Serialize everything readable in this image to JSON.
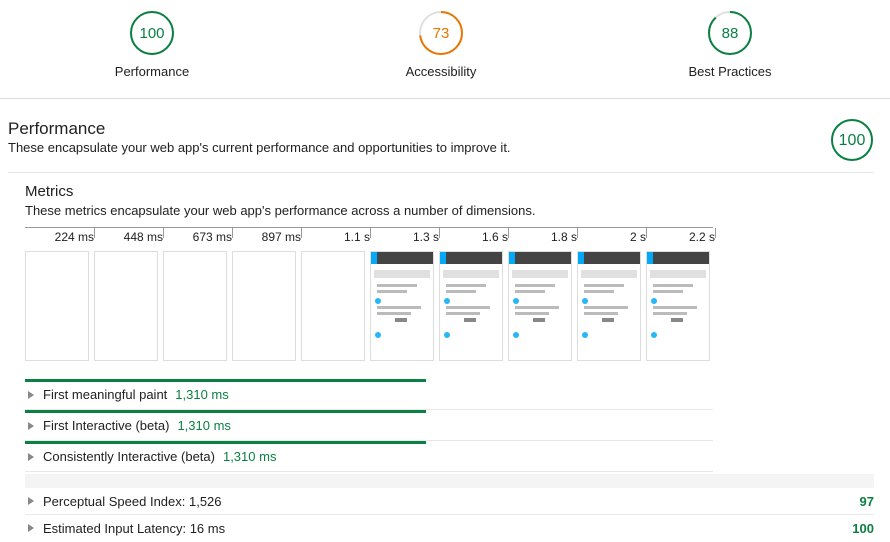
{
  "colors": {
    "pass": "#0b8043",
    "average": "#e67700",
    "track": "#e0e0e0",
    "timeline_bar": "#0b8043"
  },
  "categories": [
    {
      "score": "100",
      "label": "Performance",
      "status": "pass",
      "fraction": 1.0
    },
    {
      "score": "73",
      "label": "Accessibility",
      "status": "average",
      "fraction": 0.73
    },
    {
      "score": "88",
      "label": "Best Practices",
      "status": "pass",
      "fraction": 0.88
    }
  ],
  "section": {
    "title": "Performance",
    "description": "These encapsulate your web app's current performance and opportunities to improve it.",
    "score": "100"
  },
  "metrics": {
    "title": "Metrics",
    "description": "These metrics encapsulate your web app's performance across a number of dimensions.",
    "timeline_ticks": [
      "224 ms",
      "448 ms",
      "673 ms",
      "897 ms",
      "1.1 s",
      "1.3 s",
      "1.6 s",
      "1.8 s",
      "2 s",
      "2.2 s"
    ],
    "frames_painted": [
      false,
      false,
      false,
      false,
      false,
      true,
      true,
      true,
      true,
      true
    ],
    "items": [
      {
        "name": "First meaningful paint",
        "value": "1,310 ms",
        "progress_fraction": 0.583
      },
      {
        "name": "First Interactive (beta)",
        "value": "1,310 ms",
        "progress_fraction": 0.583
      },
      {
        "name": "Consistently Interactive (beta)",
        "value": "1,310 ms",
        "progress_fraction": 0.583
      }
    ]
  },
  "audits": [
    {
      "name": "Perceptual Speed Index: 1,526",
      "score": "97"
    },
    {
      "name": "Estimated Input Latency: 16 ms",
      "score": "100"
    }
  ]
}
